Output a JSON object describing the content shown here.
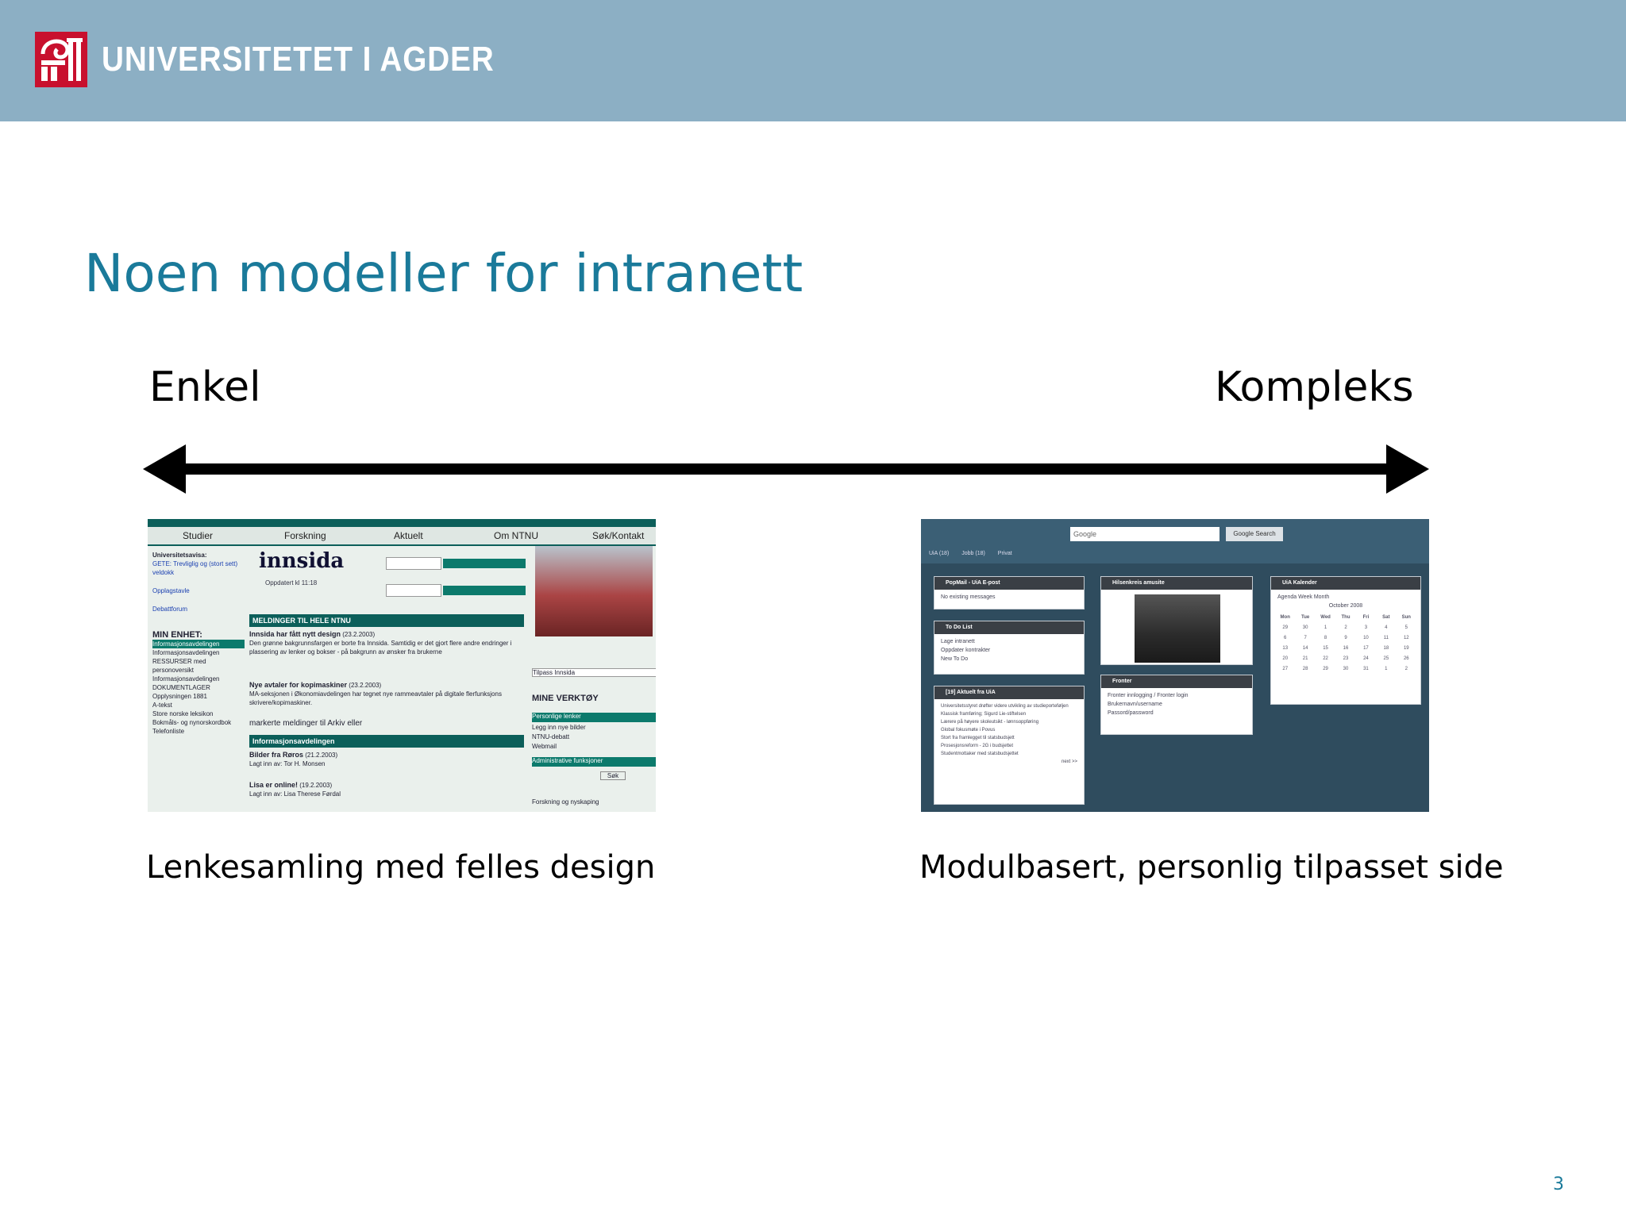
{
  "header": {
    "brand": "UNIVERSITETET I AGDER",
    "logo_icon": "uia-logo-icon"
  },
  "slide": {
    "title": "Noen modeller for intranett",
    "left_label": "Enkel",
    "right_label": "Kompleks",
    "left_caption": "Lenkesamling med felles design",
    "right_caption": "Modulbasert, personlig tilpasset side",
    "page_number": "3"
  },
  "ntnu_shot": {
    "nav": [
      "Studier",
      "Forskning",
      "Aktuelt",
      "Om NTNU",
      "Søk/Kontakt"
    ],
    "brand": "innsida",
    "updated": "Oppdatert kl 11:18",
    "side": [
      "Universitetsavisa:",
      "GETE: Trevliglig og (stort sett) veldokk",
      "Opplagstavle",
      "Debattforum",
      "MIN ENHET:",
      "Informasjonsavdelingen",
      "Informasjonsavdelingen",
      "RESSURSER med personoversikt",
      "Informasjonsavdelingen",
      "DOKUMENTLAGER",
      "Opplysningen 1881",
      "A-tekst",
      "Store norske leksikon",
      "Bokmåls- og nynorskordbok",
      "Telefonliste"
    ],
    "section1": "MELDINGER TIL HELE NTNU",
    "news1_title": "Innsida har fått nytt design",
    "news1_date": "(23.2.2003)",
    "news1_text": "Den grønne bakgrunnsfargen er borte fra Innsida. Samtidig er det gjort flere andre endringer i plassering av lenker og bokser - på bakgrunn av ønsker fra brukerne",
    "news2_title": "Nye avtaler for kopimaskiner",
    "news2_date": "(23.2.2003)",
    "news2_text": "MA-seksjonen i Økonomiavdelingen har tegnet nye rammeavtaler på digitale flerfunksjons skrivere/kopimaskiner.",
    "mark_text": "markerte meldinger til Arkiv eller",
    "section2": "Informasjonsavdelingen",
    "news3_title": "Bilder fra Røros",
    "news3_date": "(21.2.2003)",
    "news3_text": "Lagt inn av: Tor H. Monsen",
    "news4_title": "Lisa er online!",
    "news4_date": "(19.2.2003)",
    "news4_text": "Lagt inn av: Lisa Therese Førdal",
    "right_col": [
      "Tilpass Innsida",
      "MINE VERKTØY",
      "Personlige lenker",
      "Legg inn nye bilder",
      "NTNU-debatt",
      "Webmail",
      "Administrative funksjoner",
      "Søk",
      "Forskning og nyskaping"
    ]
  },
  "uia_shot": {
    "google_placeholder": "Google",
    "google_button": "Google Search",
    "tabs": [
      "UiA (18)",
      "Jobb (18)",
      "Privat"
    ],
    "panel1": {
      "title": "PopMail - UiA E-post",
      "items": [
        "No existing messages"
      ]
    },
    "panel2": {
      "title": "To Do List",
      "items": [
        "Lage intranett",
        "Oppdater kontrakter",
        "New To Do"
      ]
    },
    "panel3": {
      "title": "[19] Aktuelt fra UiA",
      "items": [
        "Universitetsstyret drøfter videre utvikling av studieporteføljen",
        "Klassisk framføring; Sigurd Lie-stiftelsen",
        "Lærere på høyere skoleutsikt - lønnsoppføring",
        "Global fokusmøte i Povus",
        "Stort fra framlegget til statsbudsjett",
        "Prosesjonsreform - 2G i budsjettet",
        "Studentmottaker med statsbudsjettet",
        "next >>"
      ]
    },
    "panel4": {
      "title": "Hilsenkreis amusite"
    },
    "panel5": {
      "title": "Fronter",
      "items": [
        "Fronter innlogging / Fronter login",
        "Brukernavn/username",
        "Passord/password"
      ]
    },
    "panel6": {
      "title": "UiA Kalender",
      "views": [
        "Agenda",
        "Week",
        "Month"
      ],
      "month": "October 2008",
      "weekdays": [
        "Mon",
        "Tue",
        "Wed",
        "Thu",
        "Fri",
        "Sat",
        "Sun"
      ],
      "days": [
        "29",
        "30",
        "1",
        "2",
        "3",
        "4",
        "5",
        "6",
        "7",
        "8",
        "9",
        "10",
        "11",
        "12",
        "13",
        "14",
        "15",
        "16",
        "17",
        "18",
        "19",
        "20",
        "21",
        "22",
        "23",
        "24",
        "25",
        "26",
        "27",
        "28",
        "29",
        "30",
        "31",
        "1",
        "2"
      ]
    }
  },
  "colors": {
    "header_bg": "#8cafc4",
    "title": "#1a7a9a",
    "logo": "#c8102e"
  }
}
